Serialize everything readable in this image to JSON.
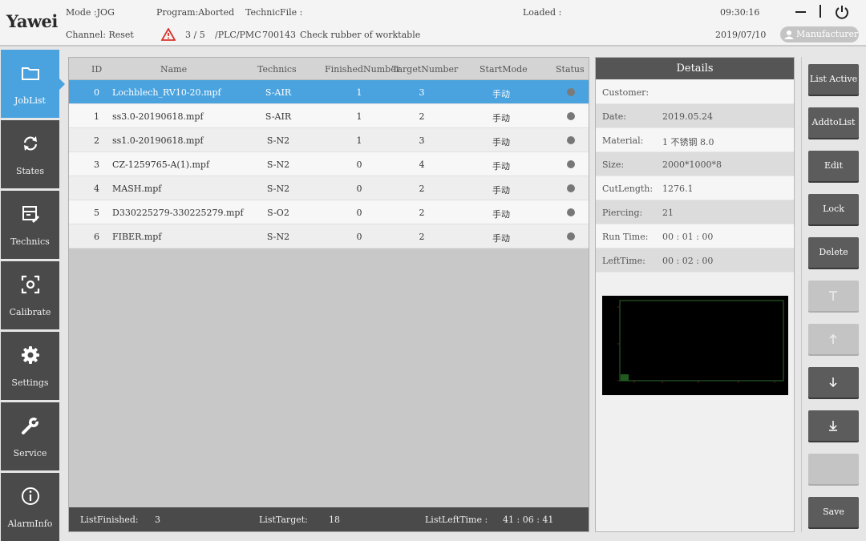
{
  "header": {
    "logo": "Yawei",
    "mode": "Mode :JOG",
    "program": "Program:Aborted",
    "technic_file": "TechnicFile :",
    "loaded": "Loaded :",
    "time": "09:30:16",
    "channel": "Channel: Reset",
    "alarm_count": "3 / 5",
    "alarm_source": "/PLC/PMC",
    "alarm_code": "700143",
    "alarm_message": "Check rubber of worktable",
    "date": "2019/07/10",
    "user": "Manufacturer",
    "minimize_icon": "minus-icon",
    "power_icon": "power-icon",
    "alarm_color": "#d9342b"
  },
  "sidebar": {
    "accent": "#4aa3df",
    "items": [
      {
        "label": "JobList",
        "icon": "folder-icon",
        "active": true
      },
      {
        "label": "States",
        "icon": "refresh-icon"
      },
      {
        "label": "Technics",
        "icon": "technics-icon"
      },
      {
        "label": "Calibrate",
        "icon": "calibrate-icon"
      },
      {
        "label": "Settings",
        "icon": "gear-icon"
      },
      {
        "label": "Service",
        "icon": "wrench-icon"
      },
      {
        "label": "AlarmInfo",
        "icon": "info-icon"
      }
    ]
  },
  "table": {
    "columns": [
      "ID",
      "Name",
      "Technics",
      "FinishedNumber",
      "TargetNumber",
      "StartMode",
      "Status"
    ],
    "rows": [
      {
        "id": "0",
        "name": "Lochblech_RV10-20.mpf",
        "technics": "S-AIR",
        "finished": "1",
        "target": "3",
        "start_mode": "手动"
      },
      {
        "id": "1",
        "name": "ss3.0-20190618.mpf",
        "technics": "S-AIR",
        "finished": "1",
        "target": "2",
        "start_mode": "手动"
      },
      {
        "id": "2",
        "name": "ss1.0-20190618.mpf",
        "technics": "S-N2",
        "finished": "1",
        "target": "3",
        "start_mode": "手动"
      },
      {
        "id": "3",
        "name": "CZ-1259765-A(1).mpf",
        "technics": "S-N2",
        "finished": "0",
        "target": "4",
        "start_mode": "手动"
      },
      {
        "id": "4",
        "name": "MASH.mpf",
        "technics": "S-N2",
        "finished": "0",
        "target": "2",
        "start_mode": "手动"
      },
      {
        "id": "5",
        "name": "D330225279-330225279.mpf",
        "technics": "S-O2",
        "finished": "0",
        "target": "2",
        "start_mode": "手动"
      },
      {
        "id": "6",
        "name": "FIBER.mpf",
        "technics": "S-N2",
        "finished": "0",
        "target": "2",
        "start_mode": "手动"
      }
    ],
    "selected_row": 0,
    "footer": {
      "list_finished_label": "ListFinished:",
      "list_finished": "3",
      "list_target_label": "ListTarget:",
      "list_target": "18",
      "list_left_time_label": "ListLeftTime :",
      "list_left_time": "41 : 06 : 41"
    }
  },
  "details": {
    "title": "Details",
    "fields": [
      {
        "key": "Customer:",
        "value": ""
      },
      {
        "key": "Date:",
        "value": "2019.05.24"
      },
      {
        "key": "Material:",
        "value": "1  不锈钢 8.0"
      },
      {
        "key": "Size:",
        "value": "2000*1000*8"
      },
      {
        "key": "CutLength:",
        "value": "1276.1"
      },
      {
        "key": "Piercing:",
        "value": "21"
      },
      {
        "key": "Run Time:",
        "value": "00 : 01 : 00"
      },
      {
        "key": "LeftTime:",
        "value": "00 : 02 : 00"
      }
    ]
  },
  "buttons": [
    {
      "label": "List Active",
      "enabled": true
    },
    {
      "label": "AddtoList",
      "enabled": true
    },
    {
      "label": "Edit",
      "enabled": true
    },
    {
      "label": "Lock",
      "enabled": true
    },
    {
      "label": "Delete",
      "enabled": true
    },
    {
      "label": "",
      "icon": "move-top-icon",
      "enabled": false
    },
    {
      "label": "",
      "icon": "move-up-icon",
      "enabled": false
    },
    {
      "label": "",
      "icon": "move-down-icon",
      "enabled": true
    },
    {
      "label": "",
      "icon": "move-bottom-icon",
      "enabled": true
    },
    {
      "label": "",
      "enabled": false
    },
    {
      "label": "Save",
      "enabled": true
    }
  ]
}
